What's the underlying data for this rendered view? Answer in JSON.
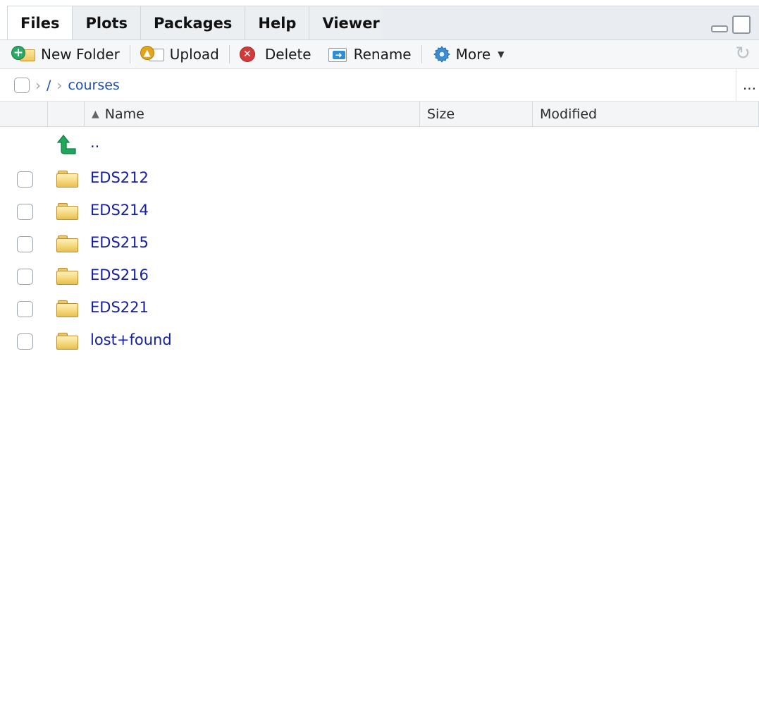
{
  "tabs": [
    {
      "label": "Files"
    },
    {
      "label": "Plots"
    },
    {
      "label": "Packages"
    },
    {
      "label": "Help"
    },
    {
      "label": "Viewer"
    }
  ],
  "toolbar": {
    "new_folder": "New Folder",
    "upload": "Upload",
    "delete": "Delete",
    "rename": "Rename",
    "more": "More"
  },
  "breadcrumb": {
    "root": "/",
    "current": "courses",
    "more": "..."
  },
  "columns": {
    "name": "Name",
    "size": "Size",
    "modified": "Modified"
  },
  "parent_dir": "..",
  "files": [
    {
      "name": "EDS212"
    },
    {
      "name": "EDS214"
    },
    {
      "name": "EDS215"
    },
    {
      "name": "EDS216"
    },
    {
      "name": "EDS221"
    },
    {
      "name": "lost+found"
    }
  ],
  "colors": {
    "link": "#15209a",
    "folder": "#f4d87c",
    "up_arrow": "#1fa85b"
  }
}
